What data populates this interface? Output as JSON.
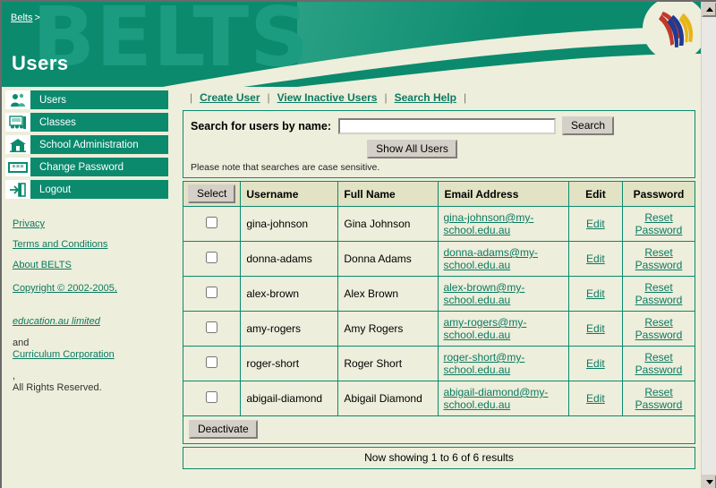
{
  "header": {
    "watermark": "BELTS",
    "breadcrumb_link": "Belts",
    "breadcrumb_separator": ">",
    "page_title": "Users",
    "logo_name": "education-au-logo",
    "bg_color": "#0B8A6E",
    "cream_color": "#EDEEDB"
  },
  "sidebar": {
    "items": [
      {
        "label": "Users",
        "icon": "users-icon"
      },
      {
        "label": "Classes",
        "icon": "classes-icon"
      },
      {
        "label": "School Administration",
        "icon": "school-icon"
      },
      {
        "label": "Change Password",
        "icon": "password-icon"
      },
      {
        "label": "Logout",
        "icon": "logout-icon"
      }
    ],
    "footer_links": [
      "Privacy",
      "Terms and Conditions",
      "About BELTS"
    ],
    "copyright": {
      "line1": "Copyright © 2002-2005,",
      "line2": "education.au limited",
      "line2_suffix": " and",
      "line3": "Curriculum Corporation",
      "line3_suffix": ",",
      "line4": "All Rights Reserved."
    }
  },
  "main": {
    "top_links": [
      "Create User",
      "View Inactive Users",
      "Search Help"
    ],
    "search": {
      "label": "Search for users by name:",
      "value": "",
      "placeholder": "",
      "search_button": "Search",
      "show_all_button": "Show All Users",
      "note": "Please note that searches are case sensitive."
    },
    "table": {
      "select_button": "Select",
      "columns": [
        "Username",
        "Full Name",
        "Email Address",
        "Edit",
        "Password"
      ],
      "edit_label": "Edit",
      "reset_label": "Reset Password",
      "rows": [
        {
          "username": "gina-johnson",
          "fullname": "Gina Johnson",
          "email": "gina-johnson@my-school.edu.au",
          "checked": false
        },
        {
          "username": "donna-adams",
          "fullname": "Donna Adams",
          "email": "donna-adams@my-school.edu.au",
          "checked": false
        },
        {
          "username": "alex-brown",
          "fullname": "Alex Brown",
          "email": "alex-brown@my-school.edu.au",
          "checked": false
        },
        {
          "username": "amy-rogers",
          "fullname": "Amy Rogers",
          "email": "amy-rogers@my-school.edu.au",
          "checked": false
        },
        {
          "username": "roger-short",
          "fullname": "Roger Short",
          "email": "roger-short@my-school.edu.au",
          "checked": false
        },
        {
          "username": "abigail-diamond",
          "fullname": "Abigail Diamond",
          "email": "abigail-diamond@my-school.edu.au",
          "checked": false
        }
      ]
    },
    "deactivate_button": "Deactivate",
    "results_text": "Now showing 1 to 6 of 6 results"
  },
  "scrollbar": {
    "up_icon": "scroll-up-arrow",
    "down_icon": "scroll-down-arrow"
  }
}
